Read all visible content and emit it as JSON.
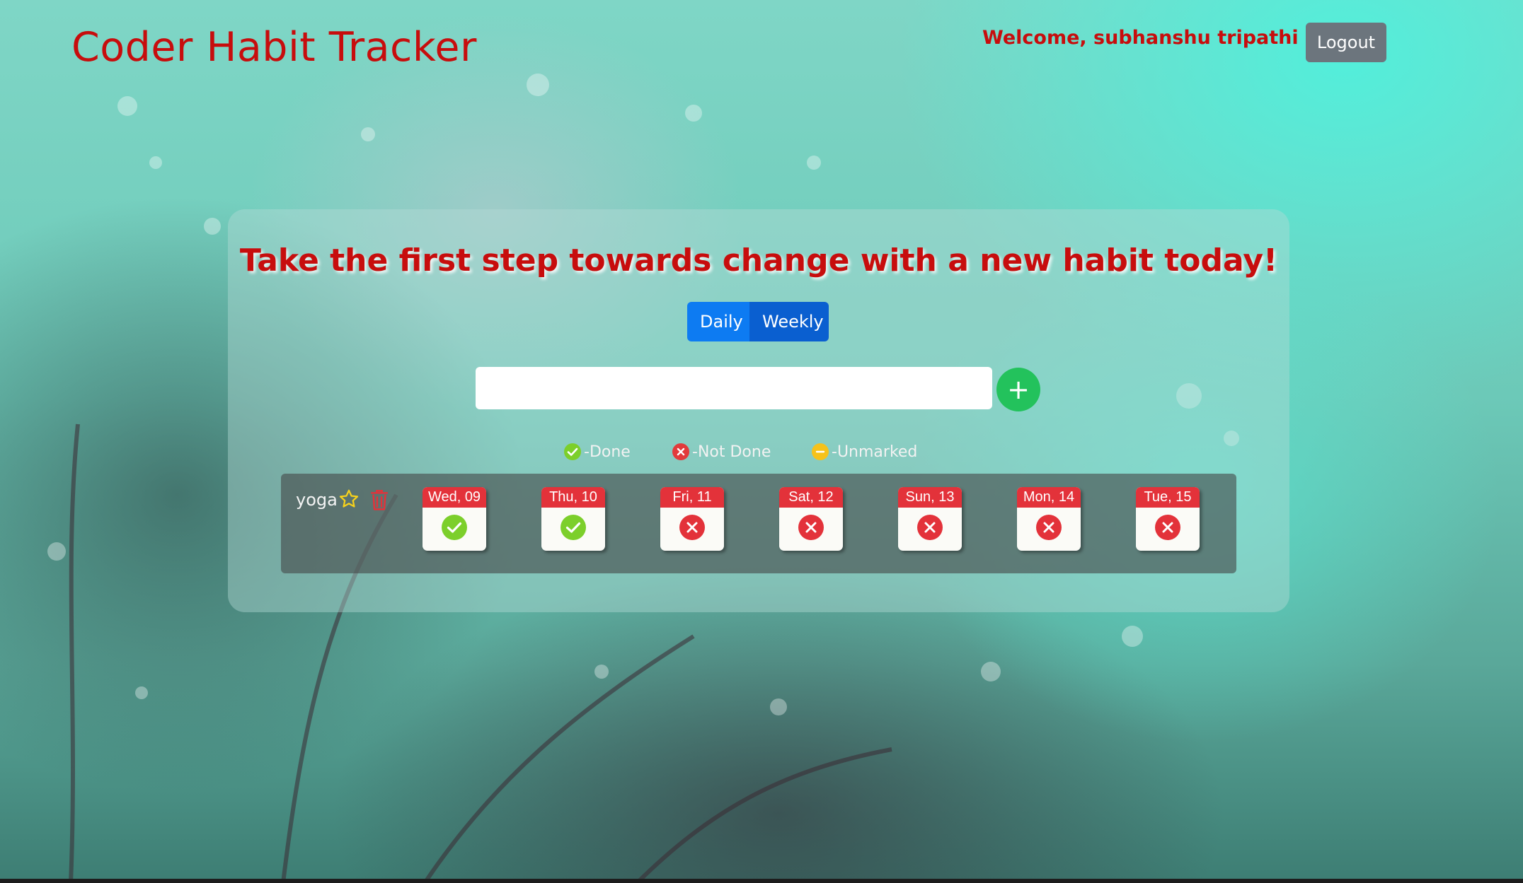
{
  "header": {
    "brand": "Coder Habit Tracker",
    "welcome": "Welcome, subhanshu tripathi",
    "logout_label": "Logout"
  },
  "main": {
    "headline": "Take the first step towards change with a new habit today!",
    "view_toggle": {
      "daily_label": "Daily",
      "weekly_label": "Weekly"
    },
    "new_habit_input": {
      "value": "",
      "placeholder": ""
    },
    "add_button_label": "+",
    "legend": {
      "done": "-Done",
      "not_done": "-Not Done",
      "unmarked": "-Unmarked"
    },
    "habits": [
      {
        "name": "yoga",
        "days": [
          {
            "label": "Wed, 09",
            "status": "done"
          },
          {
            "label": "Thu, 10",
            "status": "done"
          },
          {
            "label": "Fri, 11",
            "status": "not_done"
          },
          {
            "label": "Sat, 12",
            "status": "not_done"
          },
          {
            "label": "Sun, 13",
            "status": "not_done"
          },
          {
            "label": "Mon, 14",
            "status": "not_done"
          },
          {
            "label": "Tue, 15",
            "status": "not_done"
          }
        ]
      }
    ]
  },
  "colors": {
    "brand_red": "#c70d0d",
    "done_green": "#7ccf2b",
    "not_done_red": "#e23b3b",
    "unmarked_yellow": "#f6c21b",
    "primary_blue": "#0d7bf2",
    "add_green": "#23c25c"
  },
  "icons": {
    "star": "star-outline-icon",
    "trash": "trash-icon",
    "done": "check-circle-icon",
    "not_done": "x-circle-icon",
    "unmarked": "minus-circle-icon"
  }
}
